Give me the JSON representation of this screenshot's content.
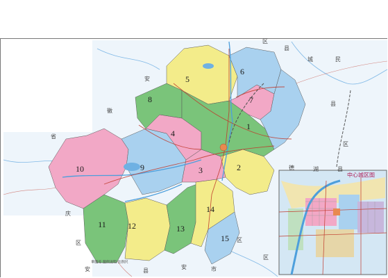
{
  "districts": [
    {
      "label": "1",
      "color": "#7ac47a"
    },
    {
      "label": "2",
      "color": "#f3ec8a"
    },
    {
      "label": "3",
      "color": "#f2a8c6"
    },
    {
      "label": "4",
      "color": "#f2a8c6"
    },
    {
      "label": "5",
      "color": "#f3ec8a"
    },
    {
      "label": "6",
      "color": "#a9d1ef"
    },
    {
      "label": "7",
      "color": "#f2a8c6"
    },
    {
      "label": "8",
      "color": "#7ac47a"
    },
    {
      "label": "9",
      "color": "#a9d1ef"
    },
    {
      "label": "10",
      "color": "#f2a8c6"
    },
    {
      "label": "11",
      "color": "#7ac47a"
    },
    {
      "label": "12",
      "color": "#f3ec8a"
    },
    {
      "label": "13",
      "color": "#7ac47a"
    },
    {
      "label": "14",
      "color": "#f3ec8a"
    },
    {
      "label": "15",
      "color": "#a9d1ef"
    }
  ],
  "map_words": [
    "区",
    "县",
    "城",
    "民",
    "安",
    "徽",
    "省",
    "区",
    "县",
    "德",
    "湖",
    "县",
    "庆",
    "区",
    "安",
    "安",
    "市",
    "区",
    "县",
    "区"
  ],
  "inset": {
    "title": "中心城区图"
  },
  "bottom_note": "审图号 图例说明 比例尺",
  "colors": {
    "background": "#ffffff",
    "outside_land": "#eef5fb",
    "water": "#6fb1e3",
    "roads": "#c0392b",
    "rail": "#555555",
    "urban": "#e8894f"
  }
}
